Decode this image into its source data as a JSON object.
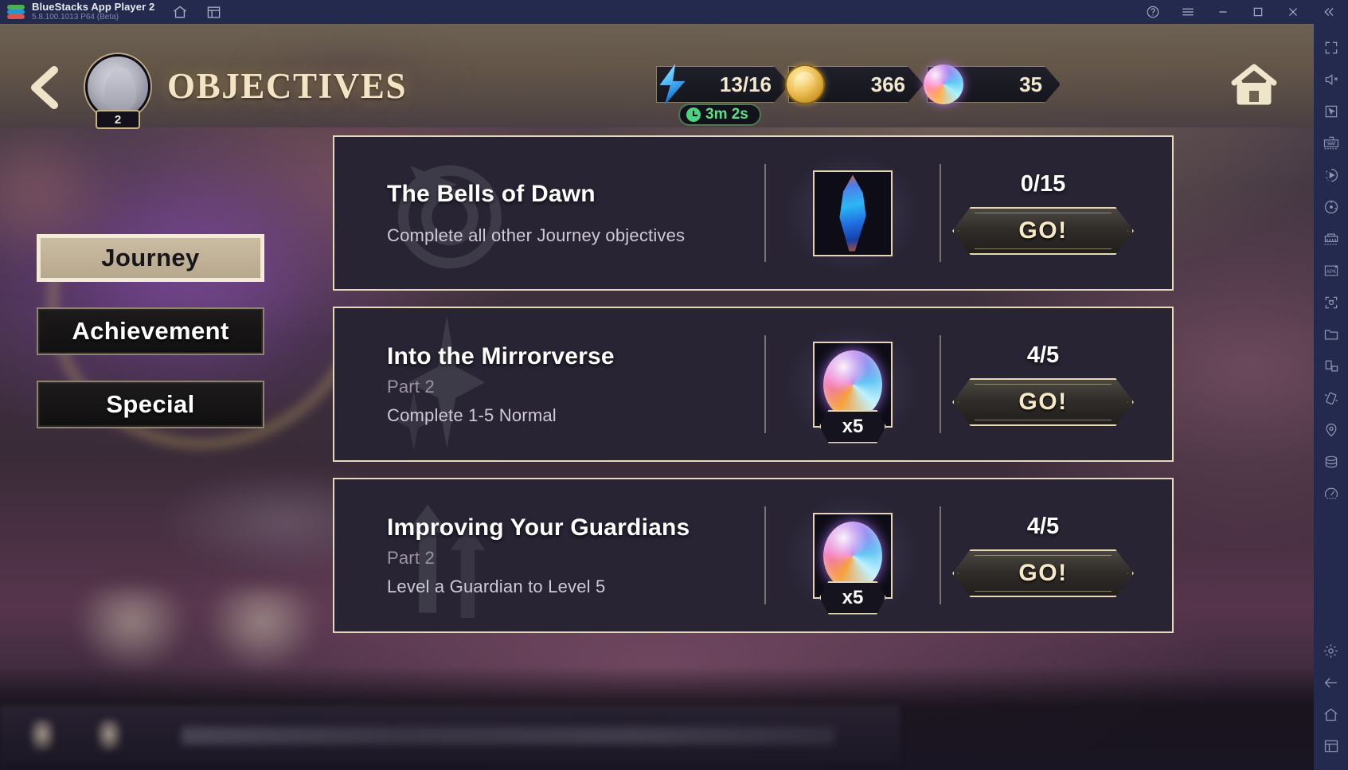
{
  "titlebar": {
    "app_name": "BlueStacks App Player 2",
    "version": "5.8.100.1013  P64 (Beta)",
    "left_icons": [
      {
        "name": "home-icon"
      },
      {
        "name": "multi-instance-icon"
      }
    ],
    "right_icons": [
      {
        "name": "help-icon"
      },
      {
        "name": "menu-icon"
      },
      {
        "name": "minimize-icon"
      },
      {
        "name": "maximize-icon"
      },
      {
        "name": "close-icon"
      },
      {
        "name": "collapse-icon"
      }
    ]
  },
  "sidebar": {
    "items": [
      {
        "name": "fullscreen-icon"
      },
      {
        "name": "mute-icon"
      },
      {
        "name": "cursor-icon"
      },
      {
        "name": "keymapping-icon"
      },
      {
        "name": "macro-record-icon"
      },
      {
        "name": "sync-icon"
      },
      {
        "name": "multi-instance-manager-icon"
      },
      {
        "name": "install-apk-icon"
      },
      {
        "name": "screenshot-icon"
      },
      {
        "name": "media-folder-icon"
      },
      {
        "name": "rotate-window-icon"
      },
      {
        "name": "shake-icon"
      },
      {
        "name": "location-icon"
      },
      {
        "name": "disk-cleanup-icon"
      },
      {
        "name": "performance-icon"
      }
    ],
    "bottom_items": [
      {
        "name": "settings-gear-icon"
      },
      {
        "name": "back-arrow-icon"
      },
      {
        "name": "android-home-icon"
      },
      {
        "name": "recent-apps-icon"
      }
    ]
  },
  "game": {
    "header": {
      "back_button": "back-chevron-icon",
      "avatar_level": "2",
      "title": "OBJECTIVES",
      "home_button": "home-icon",
      "resources": [
        {
          "name": "energy",
          "icon": "energy-bolt-icon",
          "value": "13/16",
          "timer": "3m 2s",
          "timer_icon": "clock-icon"
        },
        {
          "name": "gold",
          "icon": "gold-coin-icon",
          "value": "366"
        },
        {
          "name": "gem",
          "icon": "prism-orb-icon",
          "value": "35"
        }
      ]
    },
    "tabs": [
      {
        "label": "Journey",
        "active": true
      },
      {
        "label": "Achievement",
        "active": false
      },
      {
        "label": "Special",
        "active": false
      }
    ],
    "objectives": [
      {
        "title": "The Bells of Dawn",
        "part": "",
        "description": "Complete all other Journey objectives",
        "reward_icon": "blue-shard-icon",
        "reward_count": "",
        "progress": "0/15",
        "action_label": "GO!"
      },
      {
        "title": "Into the Mirrorverse",
        "part": "Part 2",
        "description": "Complete 1-5 Normal",
        "reward_icon": "prism-orb-icon",
        "reward_count": "x5",
        "progress": "4/5",
        "action_label": "GO!"
      },
      {
        "title": "Improving Your Guardians",
        "part": "Part 2",
        "description": "Level a Guardian to Level 5",
        "reward_icon": "prism-orb-icon",
        "reward_count": "x5",
        "progress": "4/5",
        "action_label": "GO!"
      }
    ]
  },
  "colors": {
    "titlebar_bg": "#242a4d",
    "card_bg": "#282434",
    "card_border": "#e4d9bb",
    "accent_gold": "#f2e4c4",
    "active_tab_bg": "#c2b298",
    "timer_green": "#5ee08a"
  }
}
